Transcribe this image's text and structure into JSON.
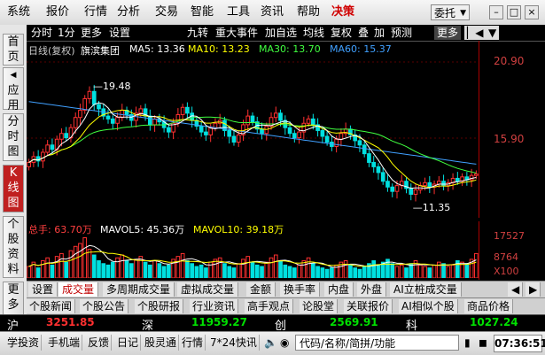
{
  "menu": {
    "items": [
      "系统",
      "报价",
      "行情",
      "分析",
      "交易",
      "智能",
      "工具",
      "资讯",
      "帮助"
    ],
    "highlight": "决策",
    "trade_button": "委托",
    "controls": [
      "–",
      "□",
      "×"
    ]
  },
  "left_tabs": [
    "首页",
    "应用",
    "分时图",
    "K线图",
    "个股资料",
    "更多"
  ],
  "toolbar": {
    "left": [
      "分时",
      "1分",
      "更多",
      "设置"
    ],
    "right": [
      "九转",
      "重大事件",
      "加自选",
      "均线",
      "复权",
      "叠",
      "加",
      "预测",
      "更多"
    ]
  },
  "indicator": {
    "period": "日线(复权)",
    "stock_name": "旗滨集团",
    "ma5": "MA5: 13.36",
    "ma10": "MA10: 13.23",
    "ma30": "MA30: 13.70",
    "ma60": "MA60: 15.37",
    "colors": {
      "ma5": "#ffffff",
      "ma10": "#ffff00",
      "ma30": "#40ff40",
      "ma60": "#40a0ff",
      "up": "#ff3030",
      "down": "#00e0e0"
    }
  },
  "price_axis": {
    "top_price": "20.90",
    "mid_price": "15.90",
    "high_mark": "19.48",
    "low_mark": "11.35"
  },
  "volume": {
    "label": "总手: 63.70万",
    "mavol5": "MAVOL5: 45.36万",
    "mavol10": "MAVOL10: 39.18万",
    "axis_top": "17527",
    "axis_mid": "8764",
    "axis_unit": "X100"
  },
  "tabs_row1": [
    "设置",
    "成交量",
    "多周期成交量",
    "虚拟成交量",
    "金额",
    "换手率",
    "内盘",
    "外盘",
    "AI立桩成交量"
  ],
  "tabs_row2": [
    "个股新闻",
    "个股公告",
    "个股研报",
    "行业资讯",
    "高手观点",
    "论股堂",
    "关联报价",
    "AI相似个股",
    "商品价格"
  ],
  "index_bar": [
    {
      "name": "沪",
      "value": "3251.85"
    },
    {
      "name": "深",
      "value": "11959.27"
    },
    {
      "name": "创",
      "value": "2569.91"
    },
    {
      "name": "科",
      "value": "1027.24"
    }
  ],
  "status_bar": {
    "items": [
      "学投资",
      "手机端",
      "反馈",
      "日记",
      "股灵通",
      "行情",
      "7*24快讯"
    ],
    "search_placeholder": "代码/名称/简拼/功能",
    "time": "07:36:51"
  },
  "chart_data": {
    "type": "candlestick",
    "y_axis_range": [
      10.5,
      21.5
    ],
    "annotated_high": 19.48,
    "annotated_low": 11.35,
    "closes": [
      14.2,
      14.6,
      14.3,
      14.9,
      15.4,
      15.1,
      15.8,
      16.2,
      15.9,
      16.6,
      17.3,
      17.8,
      18.6,
      19.1,
      18.2,
      17.9,
      17.4,
      17.2,
      16.9,
      17.3,
      17.8,
      17.5,
      17.1,
      17.6,
      17.9,
      17.4,
      16.8,
      17.2,
      17.0,
      16.6,
      16.3,
      16.9,
      17.5,
      18.0,
      17.6,
      17.1,
      16.7,
      16.3,
      16.1,
      16.6,
      16.9,
      17.1,
      16.4,
      16.0,
      15.6,
      16.1,
      16.8,
      17.4,
      17.0,
      16.5,
      16.2,
      16.7,
      17.3,
      17.6,
      17.1,
      16.6,
      16.2,
      15.9,
      16.3,
      16.9,
      17.2,
      16.8,
      16.4,
      16.0,
      15.6,
      15.3,
      15.8,
      16.2,
      16.5,
      16.1,
      15.7,
      15.4,
      14.8,
      14.2,
      13.9,
      13.5,
      12.9,
      12.5,
      12.2,
      12.6,
      12.9,
      12.4,
      12.0,
      12.3,
      12.6,
      12.8,
      12.5,
      12.7,
      12.9,
      12.6,
      12.8,
      13.1,
      12.9,
      13.2,
      13.0,
      13.3,
      13.4
    ],
    "volumes": [
      8,
      11,
      7,
      12,
      14,
      9,
      15,
      17,
      11,
      19,
      22,
      24,
      28,
      20,
      16,
      12,
      10,
      9,
      11,
      14,
      16,
      12,
      10,
      13,
      15,
      11,
      9,
      12,
      10,
      8,
      9,
      13,
      15,
      17,
      12,
      10,
      8,
      9,
      7,
      11,
      13,
      14,
      10,
      8,
      7,
      10,
      13,
      15,
      11,
      9,
      8,
      11,
      14,
      16,
      12,
      9,
      8,
      7,
      9,
      12,
      14,
      10,
      8,
      7,
      6,
      7,
      9,
      11,
      12,
      9,
      7,
      6,
      8,
      10,
      12,
      9,
      11,
      13,
      10,
      8,
      9,
      7,
      10,
      12,
      9,
      8,
      7,
      9,
      11,
      10,
      8,
      9,
      12,
      11,
      10,
      13,
      17
    ]
  }
}
